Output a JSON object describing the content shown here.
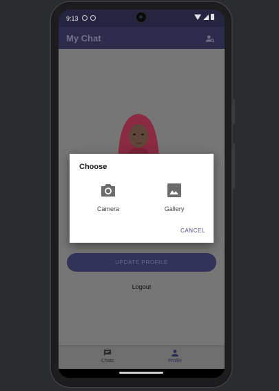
{
  "status_bar": {
    "time": "9:13"
  },
  "app_bar": {
    "title": "My Chat",
    "action_icon": "person-search-icon"
  },
  "profile": {
    "update_button_label": "UPDATE PROFILE",
    "logout_label": "Logout"
  },
  "dialog": {
    "title": "Choose",
    "options": [
      {
        "label": "Camera",
        "icon": "camera-icon"
      },
      {
        "label": "Gallery",
        "icon": "image-icon"
      }
    ],
    "cancel_label": "CANCEL"
  },
  "bottom_nav": {
    "items": [
      {
        "label": "Chats",
        "icon": "chat-icon",
        "selected": false
      },
      {
        "label": "Profile",
        "icon": "person-icon",
        "selected": true
      }
    ]
  },
  "colors": {
    "app_bar": "#2d2c4d",
    "accent": "#33335a",
    "scrim_content": "#767676",
    "dialog_bg": "#ffffff"
  }
}
